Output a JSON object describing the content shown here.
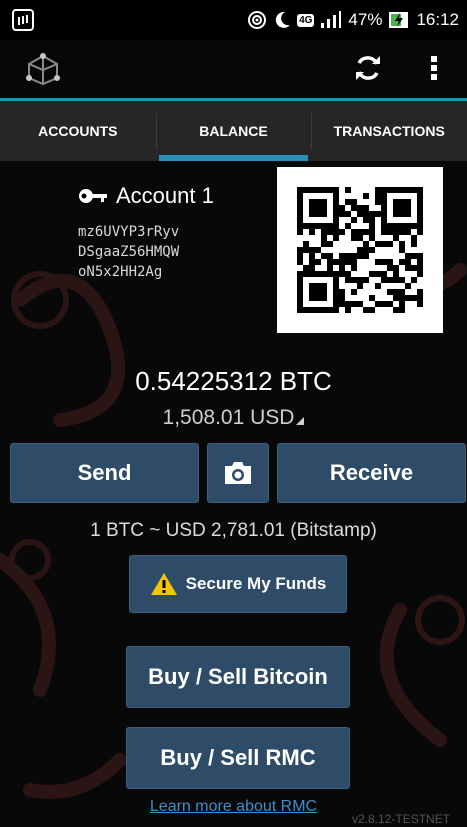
{
  "status_bar": {
    "network": "4G",
    "battery": "47%",
    "time": "16:12"
  },
  "tabs": [
    {
      "label": "ACCOUNTS",
      "active": false
    },
    {
      "label": "BALANCE",
      "active": true
    },
    {
      "label": "TRANSACTIONS",
      "active": false
    }
  ],
  "account": {
    "name": "Account 1",
    "address_lines": [
      "mz6UVYP3rRyv",
      "DSgaaZ56HMQW",
      "oN5x2HH2Ag"
    ]
  },
  "balance": {
    "btc": "0.54225312 BTC",
    "fiat": "1,508.01 USD"
  },
  "buttons": {
    "send": "Send",
    "receive": "Receive",
    "secure": "Secure My Funds",
    "buy_btc": "Buy / Sell Bitcoin",
    "buy_rmc": "Buy / Sell RMC"
  },
  "exchange_rate": "1 BTC ~ USD 2,781.01 (Bitstamp)",
  "learn_link": "Learn more about RMC",
  "version": "v2.8.12-TESTNET",
  "icons": {
    "app_logo": "mycelium-logo-icon",
    "refresh": "refresh-icon",
    "menu": "overflow-menu-icon",
    "account_key": "key-icon",
    "camera": "camera-icon",
    "warning": "warning-icon"
  },
  "colors": {
    "accent": "#2a8fb5",
    "button": "#2e4c68",
    "link": "#3a8fd0",
    "warning": "#f5c400"
  }
}
